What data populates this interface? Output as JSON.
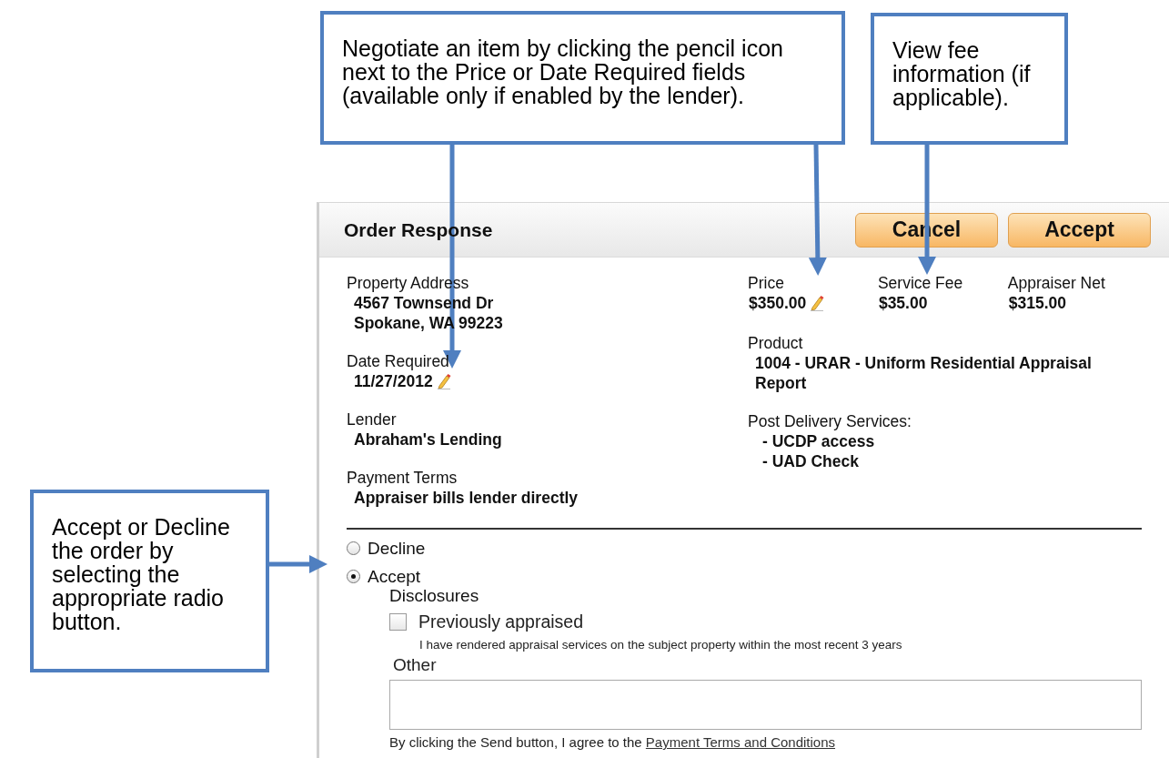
{
  "callouts": [
    {
      "text": "Negotiate an item by clicking the pencil icon next to the Price or Date Required fields (available only if enabled by the lender)."
    },
    {
      "text": "View fee information (if applicable)."
    },
    {
      "text": "Accept or Decline the order by selecting the appropriate radio button."
    }
  ],
  "dialog": {
    "title": "Order Response",
    "buttons": [
      "Cancel",
      "Accept"
    ],
    "left_fields": [
      {
        "label": "Property Address",
        "lines": [
          "4567 Townsend Dr",
          "Spokane, WA 99223"
        ],
        "editable": false
      },
      {
        "label": "Date Required",
        "lines": [
          "11/27/2012"
        ],
        "editable": true
      },
      {
        "label": "Lender",
        "lines": [
          "Abraham's Lending"
        ],
        "editable": false
      },
      {
        "label": "Payment Terms",
        "lines": [
          "Appraiser bills lender directly"
        ],
        "editable": false
      }
    ],
    "fees": [
      {
        "label": "Price",
        "value": "$350.00",
        "editable": true
      },
      {
        "label": "Service Fee",
        "value": "$35.00",
        "editable": false
      },
      {
        "label": "Appraiser Net",
        "value": "$315.00",
        "editable": false
      }
    ],
    "product": {
      "label": "Product",
      "value": "1004 - URAR - Uniform Residential Appraisal Report"
    },
    "post_delivery": {
      "label": "Post Delivery Services:",
      "items": [
        "- UCDP access",
        "- UAD Check"
      ]
    },
    "response_options": [
      {
        "label": "Decline",
        "selected": false
      },
      {
        "label": "Accept",
        "selected": true
      }
    ],
    "disclosures": {
      "heading": "Disclosures",
      "checkbox": {
        "label": "Previously appraised",
        "checked": false,
        "note": "I have rendered appraisal services on the subject property within the most recent 3 years"
      }
    },
    "other": {
      "label": "Other"
    },
    "agreement": {
      "text": "By clicking the Send button, I agree to the",
      "link": "Payment Terms and Conditions"
    }
  }
}
